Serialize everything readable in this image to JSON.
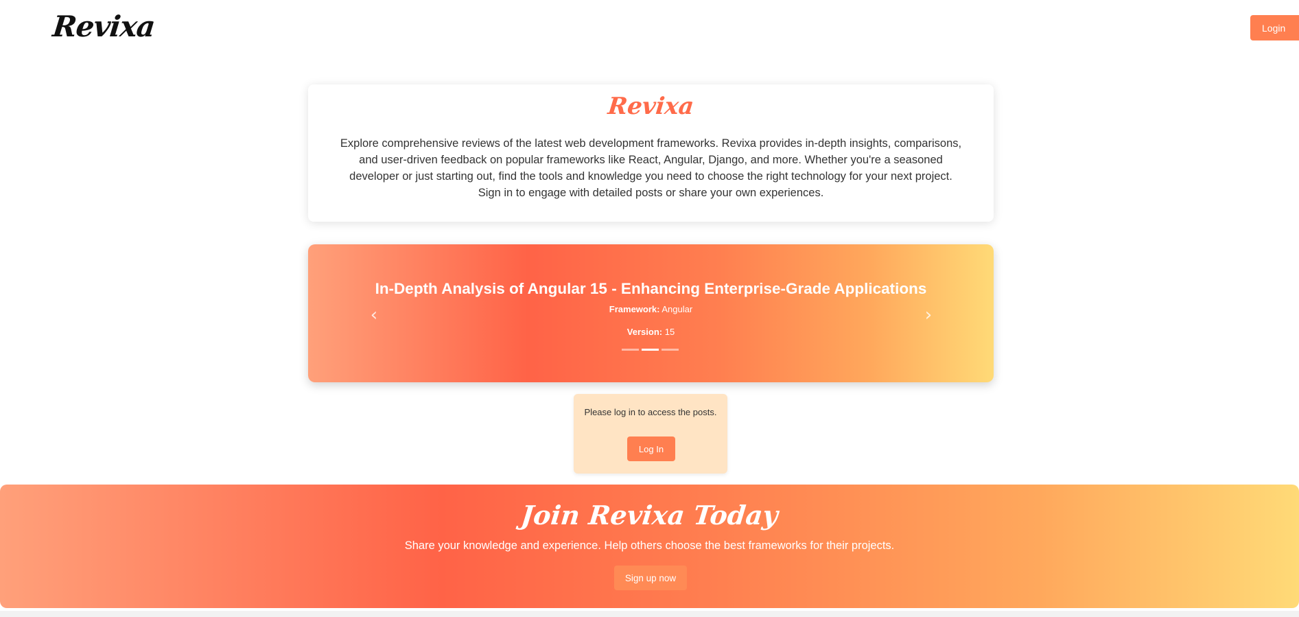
{
  "header": {
    "brand": "Revixa",
    "login_label": "Login"
  },
  "intro": {
    "title": "Revixa",
    "description": "Explore comprehensive reviews of the latest web development frameworks. Revixa provides in-depth insights, comparisons, and user-driven feedback on popular frameworks like React, Angular, Django, and more. Whether you're a seasoned developer or just starting out, find the tools and knowledge you need to choose the right technology for your next project. Sign in to engage with detailed posts or share your own experiences."
  },
  "carousel": {
    "active_index": 1,
    "slide": {
      "title": "In-Depth Analysis of Angular 15 - Enhancing Enterprise-Grade Applications",
      "framework_label": "Framework:",
      "framework_value": "Angular",
      "version_label": "Version:",
      "version_value": "15"
    },
    "prev_glyph": "‹",
    "next_glyph": "›"
  },
  "notice": {
    "text": "Please log in to access the posts.",
    "button_label": "Log In"
  },
  "cta": {
    "title": "Join Revixa Today",
    "text": "Share your knowledge and experience. Help others choose the best frameworks for their projects.",
    "button_label": "Sign up now"
  },
  "colors": {
    "accent": "#ff7f50",
    "brand_red": "#ff6b4a",
    "gradient_start": "#ffa07a",
    "gradient_mid": "#ff6347",
    "gradient_end": "#ffda77",
    "notice_bg": "#ffe4c4"
  }
}
